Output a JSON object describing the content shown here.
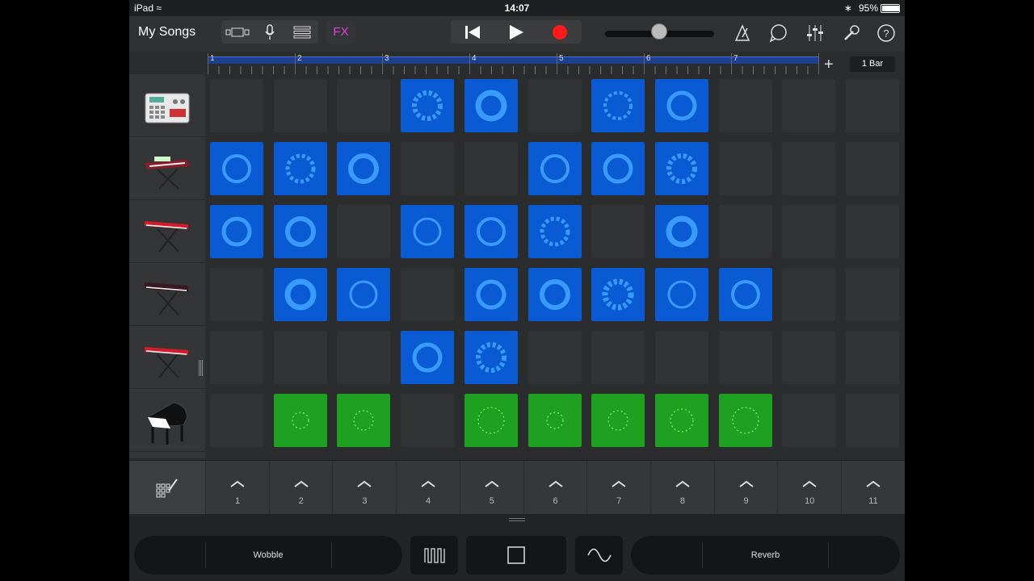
{
  "status": {
    "device": "iPad",
    "time": "14:07",
    "battery": "95%"
  },
  "toolbar": {
    "my_songs": "My Songs",
    "fx_label": "FX",
    "icons": [
      "loops-view-icon",
      "microphone-icon",
      "tracks-view-icon",
      "rewind-icon",
      "play-icon",
      "record-icon",
      "metronome-icon",
      "loop-browser-icon",
      "mixer-icon",
      "settings-icon",
      "help-icon"
    ]
  },
  "ruler": {
    "bars": [
      "1",
      "2",
      "3",
      "4",
      "5",
      "6",
      "7"
    ],
    "section_length": "1 Bar"
  },
  "tracks": [
    {
      "instrument": "drum-machine"
    },
    {
      "instrument": "synth-keyboard"
    },
    {
      "instrument": "red-keyboard"
    },
    {
      "instrument": "dark-keyboard"
    },
    {
      "instrument": "red-keyboard"
    },
    {
      "instrument": "grand-piano"
    }
  ],
  "grid": {
    "rows": [
      [
        "e",
        "e",
        "e",
        "b",
        "b",
        "e",
        "b",
        "b",
        "e",
        "e",
        "e"
      ],
      [
        "b",
        "b",
        "b",
        "e",
        "e",
        "b",
        "b",
        "b",
        "e",
        "e",
        "e"
      ],
      [
        "b",
        "b",
        "e",
        "b",
        "b",
        "b",
        "e",
        "b",
        "e",
        "e",
        "e"
      ],
      [
        "e",
        "b",
        "b",
        "e",
        "b",
        "b",
        "b",
        "b",
        "b",
        "e",
        "e"
      ],
      [
        "e",
        "e",
        "e",
        "b",
        "b",
        "e",
        "e",
        "e",
        "e",
        "e",
        "e"
      ],
      [
        "e",
        "g",
        "g",
        "e",
        "g",
        "g",
        "g",
        "g",
        "g",
        "e",
        "e"
      ]
    ]
  },
  "triggers": [
    "1",
    "2",
    "3",
    "4",
    "5",
    "6",
    "7",
    "8",
    "9",
    "10",
    "11"
  ],
  "fx": {
    "left_effect": "Wobble",
    "right_effect": "Reverb"
  },
  "colors": {
    "blue_cell": "#0a5bd3",
    "green_cell": "#1ea120",
    "empty_cell": "#313334",
    "record": "#ff1a1a",
    "fx": "#e040e0",
    "ruler": "#1d3f8f"
  }
}
